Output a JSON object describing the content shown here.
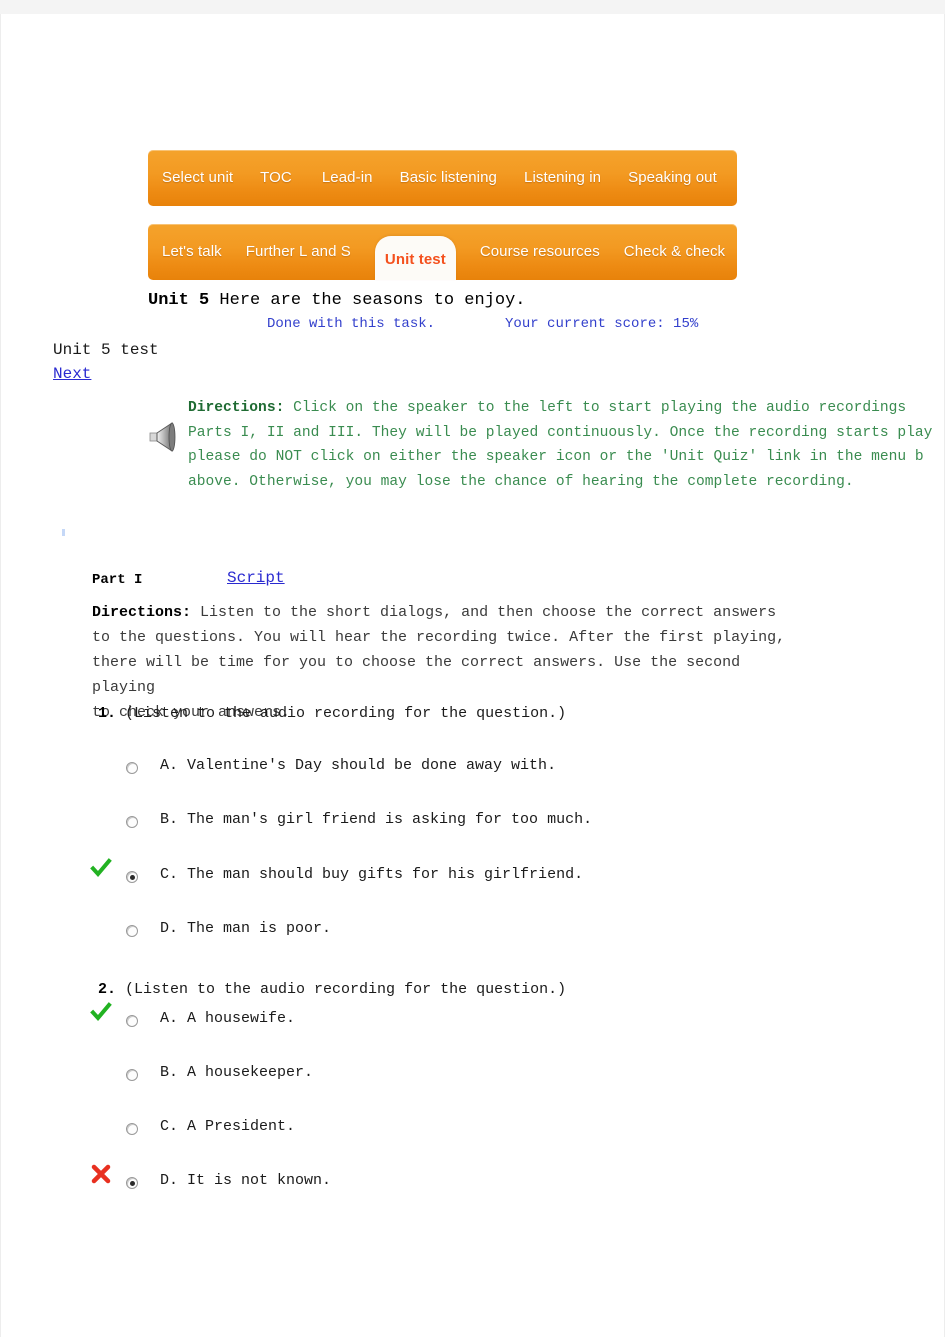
{
  "page": {
    "top_band_color": "#f4f4f4",
    "background": "#ffffff"
  },
  "nav": {
    "accent_orange": "#f09020",
    "active_tab_text_color": "#f4511e",
    "primary_row": [
      {
        "label": "Select unit",
        "active": false
      },
      {
        "label": "TOC",
        "active": false
      },
      {
        "label": "Lead-in",
        "active": false
      },
      {
        "label": "Basic listening",
        "active": false
      },
      {
        "label": "Listening in",
        "active": false
      },
      {
        "label": "Speaking out",
        "active": false
      }
    ],
    "secondary_row": [
      {
        "label": "Let's talk",
        "active": false
      },
      {
        "label": "Further L and S",
        "active": false
      },
      {
        "label": "Unit test",
        "active": true
      },
      {
        "label": "Course resources",
        "active": false
      },
      {
        "label": "Check & check",
        "active": false
      }
    ]
  },
  "header": {
    "unit_bold": "Unit 5",
    "unit_title": " Here are the seasons to enjoy.",
    "done_text": "Done with this task.",
    "score_text": "Your current score: 15%",
    "score_color": "#3340cc",
    "test_title": "Unit 5 test",
    "next_link": "Next"
  },
  "audio_directions": {
    "icon": "speaker-icon",
    "label": "Directions:",
    "lines": [
      " Click on the speaker to the left to start playing the audio recordings",
      "Parts I, II and III. They will be played continuously. Once the recording starts play",
      "please do NOT click on either the speaker icon or the 'Unit Quiz' link in the menu b",
      "above. Otherwise, you may lose the chance of hearing the complete recording."
    ],
    "text_color": "#3a8c50"
  },
  "part": {
    "label": "Part I",
    "script_link": "Script",
    "directions_label": "Directions:",
    "directions_lines": [
      " Listen to the short dialogs, and then choose the correct answers",
      "to the questions. You will hear the recording twice. After the first playing,",
      "there will be time for you to choose the correct answers. Use the second playing",
      "to check your answers."
    ]
  },
  "questions": [
    {
      "number": "1.",
      "stem": "(Listen to the audio recording for the question.)",
      "options": [
        {
          "text": "A. Valentine's Day should be done away with.",
          "selected": false,
          "mark": "none"
        },
        {
          "text": "B. The man's girl friend is asking for too much.",
          "selected": false,
          "mark": "none"
        },
        {
          "text": "C. The man should buy gifts for his girlfriend.",
          "selected": true,
          "mark": "correct"
        },
        {
          "text": "D. The man is poor.",
          "selected": false,
          "mark": "none"
        }
      ]
    },
    {
      "number": "2.",
      "stem": "(Listen to the audio recording for the question.)",
      "options": [
        {
          "text": "A. A housewife.",
          "selected": false,
          "mark": "correct"
        },
        {
          "text": "B. A housekeeper.",
          "selected": false,
          "mark": "none"
        },
        {
          "text": "C. A President.",
          "selected": false,
          "mark": "none"
        },
        {
          "text": "D. It is not known.",
          "selected": true,
          "mark": "wrong"
        }
      ]
    }
  ],
  "marks": {
    "correct_color": "#22b222",
    "wrong_color": "#e83020",
    "correct_name": "check-mark-icon",
    "wrong_name": "cross-mark-icon"
  }
}
